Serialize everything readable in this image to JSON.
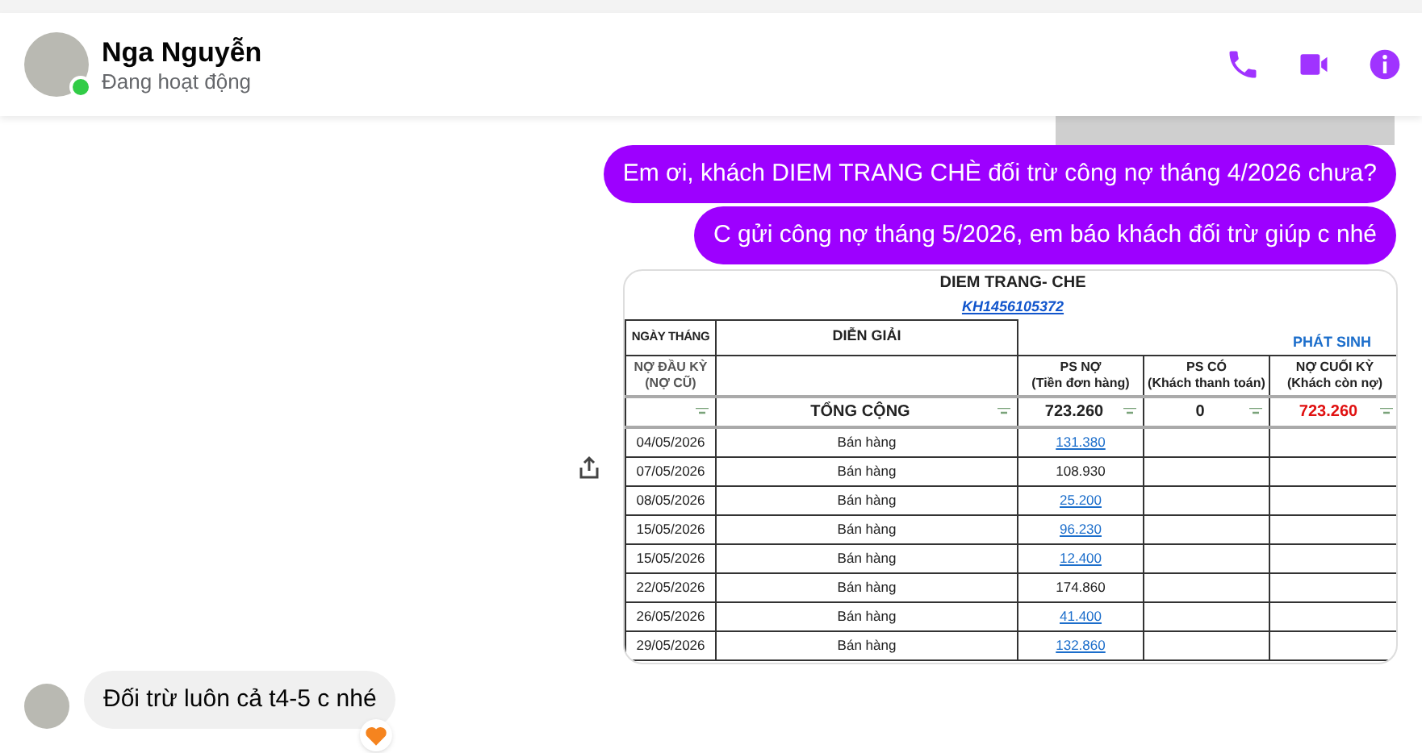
{
  "header": {
    "name": "Nga Nguyễn",
    "status": "Đang hoạt động",
    "online": true
  },
  "messages": [
    {
      "kind": "outgoing_text",
      "text": "Em ơi, khách DIEM TRANG CHÈ đối trừ công nợ tháng 4/2026 chưa?"
    },
    {
      "kind": "outgoing_text",
      "text": "C gửi công nợ tháng 5/2026, em báo khách đối trừ giúp c nhé"
    },
    {
      "kind": "sheet",
      "title": "DIEM TRANG- CHE",
      "code": "KH1456105372",
      "headers": {
        "date": "NGÀY THÁNG",
        "description": "DIỄN GIẢI",
        "group": "PHÁT SINH",
        "opening": "NỢ ĐẦU KỲ\n(NỢ CŨ)",
        "debit": "PS NỢ\n(Tiền đơn hàng)",
        "credit": "PS CÓ\n(Khách thanh toán)",
        "closing": "NỢ CUỐI KỲ\n(Khách còn nợ)"
      },
      "totals": {
        "label": "TỔNG CỘNG",
        "debit": "723.260",
        "credit": "0",
        "closing": "723.260"
      },
      "rows": [
        {
          "date": "04/05/2026",
          "description": "Bán hàng",
          "debit": "131.380",
          "linked": true
        },
        {
          "date": "07/05/2026",
          "description": "Bán hàng",
          "debit": "108.930",
          "linked": false
        },
        {
          "date": "08/05/2026",
          "description": "Bán hàng",
          "debit": "25.200",
          "linked": true
        },
        {
          "date": "15/05/2026",
          "description": "Bán hàng",
          "debit": "96.230",
          "linked": true
        },
        {
          "date": "15/05/2026",
          "description": "Bán hàng",
          "debit": "12.400",
          "linked": true
        },
        {
          "date": "22/05/2026",
          "description": "Bán hàng",
          "debit": "174.860",
          "linked": false
        },
        {
          "date": "26/05/2026",
          "description": "Bán hàng",
          "debit": "41.400",
          "linked": true
        },
        {
          "date": "29/05/2026",
          "description": "Bán hàng",
          "debit": "132.860",
          "linked": true
        }
      ]
    },
    {
      "kind": "incoming_text",
      "text": "Đối trừ luôn cả t4-5 c nhé",
      "reaction": true
    }
  ]
}
